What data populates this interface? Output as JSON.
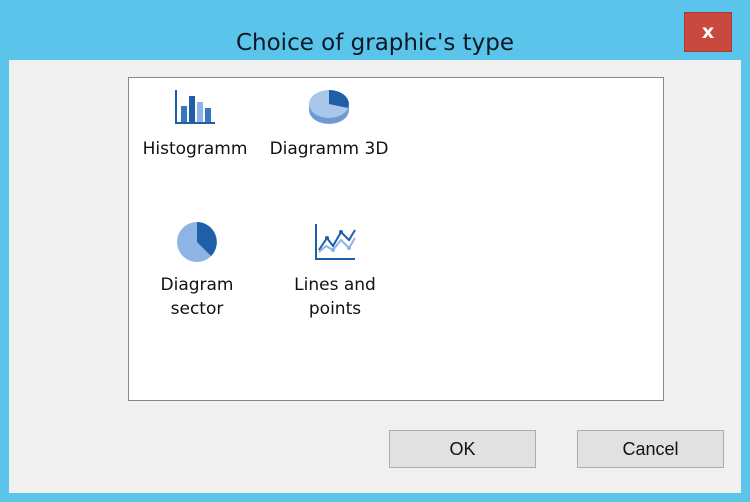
{
  "window": {
    "title": "Choice of graphic's type",
    "close_label": "x"
  },
  "chart_types": [
    {
      "label": "Histogramm",
      "icon": "histogram-icon"
    },
    {
      "label": "Diagramm 3D",
      "icon": "pie-3d-icon"
    },
    {
      "label_line1": "Diagram",
      "label_line2": "sector",
      "icon": "pie-chart-icon"
    },
    {
      "label_line1": "Lines and",
      "label_line2": "points",
      "icon": "line-chart-icon"
    }
  ],
  "buttons": {
    "ok_label": "OK",
    "cancel_label": "Cancel"
  },
  "colors": {
    "titlebar": "#5bc4ea",
    "close_button": "#c9493f",
    "icon_dark": "#1f5fa8",
    "icon_light": "#8db4e2"
  }
}
